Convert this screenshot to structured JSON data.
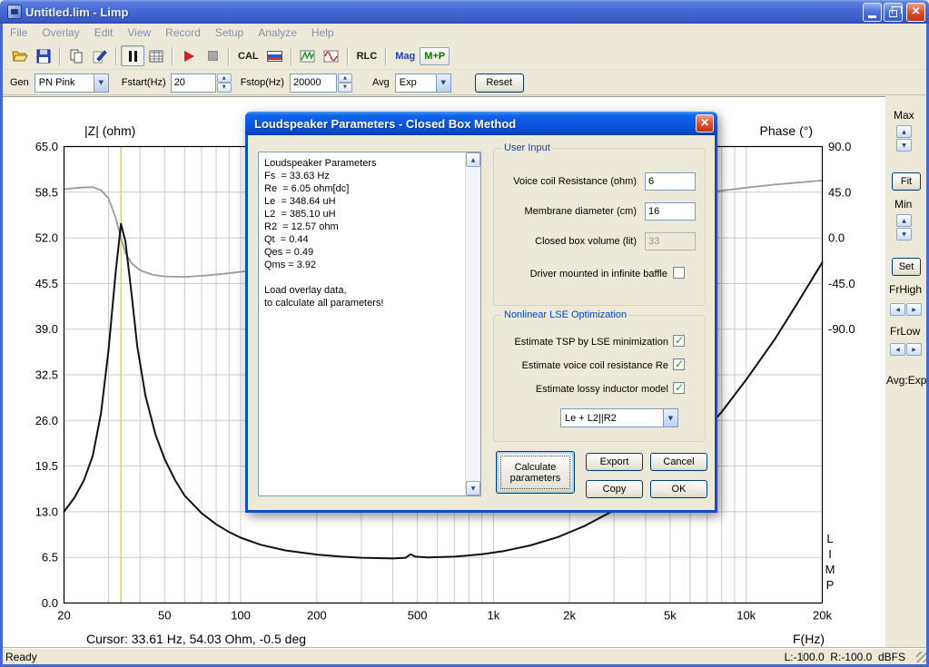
{
  "window": {
    "title": "Untitled.lim - Limp",
    "menu": [
      "File",
      "Overlay",
      "Edit",
      "View",
      "Record",
      "Setup",
      "Analyze",
      "Help"
    ],
    "status_left": "Ready",
    "status_right": "L:-100.0  R:-100.0  dBFS"
  },
  "toolbar": {
    "cal_label": "CAL",
    "rlc_label": "RLC",
    "mag_label": "Mag",
    "mp_label": "M+P",
    "icon_names": [
      "open-icon",
      "save-icon",
      "copy-icon",
      "pen-icon",
      "pause-icon",
      "table-icon",
      "play-icon",
      "stop-icon",
      "flag-icon",
      "waveform-icon",
      "sine-icon"
    ]
  },
  "gen_bar": {
    "gen_label": "Gen",
    "gen_value": "PN Pink",
    "fstart_label": "Fstart(Hz)",
    "fstart_value": "20",
    "fstop_label": "Fstop(Hz)",
    "fstop_value": "20000",
    "avg_label": "Avg",
    "avg_value": "Exp",
    "reset_label": "Reset"
  },
  "side_panel": {
    "max_label": "Max",
    "fit_label": "Fit",
    "min_label": "Min",
    "set_label": "Set",
    "frhigh_label": "FrHigh",
    "frlow_label": "FrLow",
    "avg_text": "Avg:Exp"
  },
  "chart_data": {
    "type": "line",
    "x_scale": "log",
    "x_range": [
      20,
      20000
    ],
    "xlabel": "F(Hz)",
    "grid": true,
    "z_axis": {
      "label": "|Z| (ohm)",
      "min": 0,
      "max": 65,
      "ticks": [
        "65.0",
        "58.5",
        "52.0",
        "45.5",
        "39.0",
        "32.5",
        "26.0",
        "19.5",
        "13.0",
        "6.5",
        "0.0"
      ]
    },
    "phase_axis": {
      "label": "Phase (°)",
      "max": 90,
      "deg_per_div": 45,
      "ticks": [
        "90.0",
        "45.0",
        "0.0",
        "-45.0",
        "-90.0"
      ]
    },
    "x_ticks": [
      {
        "f": 20,
        "label": "20"
      },
      {
        "f": 50,
        "label": "50"
      },
      {
        "f": 100,
        "label": "100"
      },
      {
        "f": 200,
        "label": "200"
      },
      {
        "f": 500,
        "label": "500"
      },
      {
        "f": 1000,
        "label": "1k"
      },
      {
        "f": 2000,
        "label": "2k"
      },
      {
        "f": 5000,
        "label": "5k"
      },
      {
        "f": 10000,
        "label": "10k"
      },
      {
        "f": 20000,
        "label": "20k"
      }
    ],
    "series": [
      {
        "name": "phase_deg",
        "axis": "phase",
        "color": "#9B9B9B",
        "width": 1.8,
        "points": [
          [
            20,
            48
          ],
          [
            23,
            49.5
          ],
          [
            26,
            50
          ],
          [
            28,
            47
          ],
          [
            30,
            39
          ],
          [
            32,
            20
          ],
          [
            33.6,
            0
          ],
          [
            35,
            -15
          ],
          [
            37,
            -25
          ],
          [
            40,
            -32
          ],
          [
            45,
            -36.5
          ],
          [
            50,
            -38
          ],
          [
            60,
            -38.5
          ],
          [
            70,
            -37.5
          ],
          [
            85,
            -35.5
          ],
          [
            100,
            -33.5
          ],
          [
            130,
            -30
          ],
          [
            170,
            -25
          ],
          [
            250,
            -17
          ],
          [
            400,
            -7
          ],
          [
            700,
            4
          ],
          [
            1200,
            14
          ],
          [
            2000,
            24
          ],
          [
            3000,
            31
          ],
          [
            4500,
            38
          ],
          [
            6000,
            42.5
          ],
          [
            8000,
            46.5
          ],
          [
            10000,
            49.5
          ],
          [
            13000,
            52.5
          ],
          [
            16000,
            54.5
          ],
          [
            20000,
            56.5
          ]
        ]
      },
      {
        "name": "impedance_ohm",
        "axis": "z",
        "color": "#111111",
        "width": 2,
        "points": [
          [
            20,
            13
          ],
          [
            22,
            15
          ],
          [
            24,
            17.5
          ],
          [
            26,
            21
          ],
          [
            28,
            27
          ],
          [
            30,
            36
          ],
          [
            32,
            47
          ],
          [
            33.6,
            54
          ],
          [
            35,
            51.5
          ],
          [
            37,
            44
          ],
          [
            39,
            36.5
          ],
          [
            42,
            29.5
          ],
          [
            46,
            24
          ],
          [
            50,
            20.5
          ],
          [
            55,
            17.5
          ],
          [
            60,
            15.3
          ],
          [
            70,
            12.8
          ],
          [
            80,
            11.2
          ],
          [
            90,
            10.1
          ],
          [
            100,
            9.3
          ],
          [
            120,
            8.3
          ],
          [
            150,
            7.5
          ],
          [
            200,
            6.9
          ],
          [
            250,
            6.6
          ],
          [
            300,
            6.45
          ],
          [
            400,
            6.35
          ],
          [
            450,
            6.45
          ],
          [
            470,
            6.95
          ],
          [
            490,
            6.6
          ],
          [
            550,
            6.5
          ],
          [
            700,
            6.6
          ],
          [
            900,
            6.95
          ],
          [
            1100,
            7.4
          ],
          [
            1400,
            8.2
          ],
          [
            1800,
            9.4
          ],
          [
            2300,
            11
          ],
          [
            3000,
            13.2
          ],
          [
            4000,
            16.4
          ],
          [
            5000,
            19.6
          ],
          [
            6500,
            23.6
          ],
          [
            8000,
            27.2
          ],
          [
            10000,
            31.8
          ],
          [
            13000,
            37.6
          ],
          [
            16000,
            42.8
          ],
          [
            20000,
            48.5
          ]
        ]
      }
    ],
    "cursor": {
      "freq": 33.61,
      "color": "#E5D500",
      "text": "Cursor: 33.61 Hz, 54.03 Ohm, -0.5 deg"
    },
    "watermark": "L\nI\nM\nP"
  },
  "dialog": {
    "title": "Loudspeaker Parameters - Closed Box Method",
    "results_text": "Loudspeaker Parameters\nFs  = 33.63 Hz\nRe  = 6.05 ohm[dc]\nLe  = 348.64 uH\nL2  = 385.10 uH\nR2  = 12.57 ohm\nQt  = 0.44\nQes = 0.49\nQms = 3.92\n\nLoad overlay data,\nto calculate all parameters!",
    "user_input": {
      "title": "User Input",
      "fields": [
        {
          "label": "Voice coil Resistance (ohm)",
          "value": "6",
          "disabled": false
        },
        {
          "label": "Membrane diameter (cm)",
          "value": "16",
          "disabled": false
        },
        {
          "label": "Closed box volume (lit)",
          "value": "33",
          "disabled": true
        }
      ],
      "baffle_label": "Driver mounted in infinite baffle",
      "baffle_checked": false
    },
    "lse": {
      "title": "Nonlinear LSE Optimization",
      "options": [
        "Estimate TSP by LSE minimization",
        "Estimate voice coil resistance Re",
        "Estimate lossy inductor model"
      ],
      "checked": [
        true,
        true,
        true
      ],
      "model_value": "Le + L2||R2"
    },
    "buttons": {
      "calculate": "Calculate parameters",
      "export": "Export",
      "cancel": "Cancel",
      "copy": "Copy",
      "ok": "OK"
    }
  },
  "colors": {
    "titlebar_active": "#0A54DF",
    "window_chrome": "#ECE9D8",
    "cursor_line": "#E5D500",
    "impedance_curve": "#111111",
    "phase_curve": "#9B9B9B",
    "groupbox_label": "#0046D5"
  }
}
